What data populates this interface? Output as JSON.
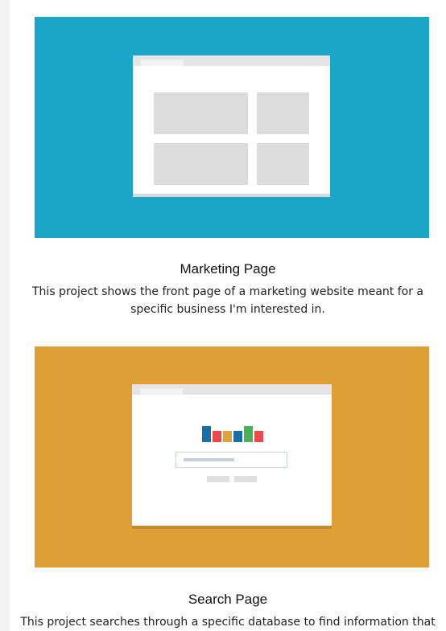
{
  "projects": [
    {
      "title": "Marketing Page",
      "description": "This project shows the front page of a marketing website meant for a specific business I'm interested in.",
      "thumb_color": "#1aa6c9",
      "icon": "marketing-page-thumbnail-icon"
    },
    {
      "title": "Search Page",
      "description": "This project searches through a specific database to find information that",
      "thumb_color": "#e09e36",
      "icon": "search-page-thumbnail-icon",
      "logo_colors": [
        "#1a6ea8",
        "#e94b4b",
        "#e0a33a",
        "#1a6ea8",
        "#4bb05a",
        "#e94b4b"
      ]
    }
  ]
}
